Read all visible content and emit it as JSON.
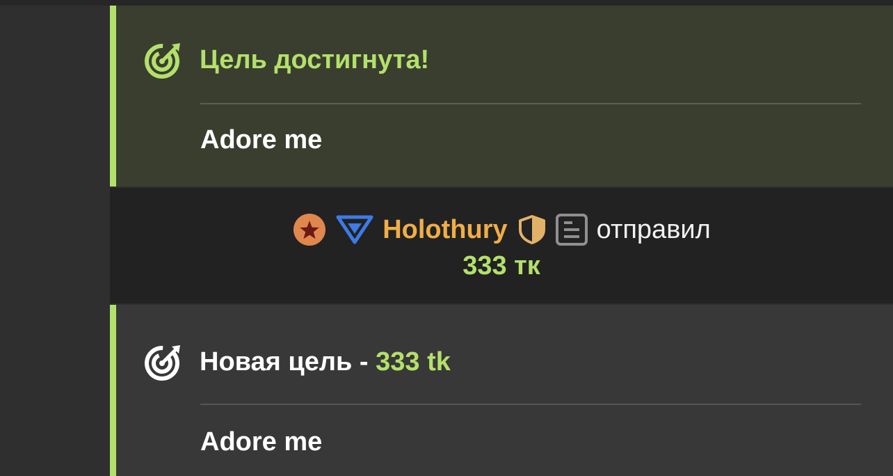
{
  "colors": {
    "accent_green": "#b3e06b",
    "username_orange": "#f0ad48",
    "goal_reached_bg": "#3a3e2f",
    "tip_bg": "#222222",
    "goal_new_bg": "#383838"
  },
  "goal_reached": {
    "icon": "target-icon",
    "title": "Цель достигнута!",
    "name": "Adore me"
  },
  "tip": {
    "badges": [
      "star-badge-icon",
      "blue-triangle-icon"
    ],
    "username": "Holothury",
    "user_icons": [
      "shield-icon",
      "document-icon"
    ],
    "action": "отправил",
    "amount": "333 тк"
  },
  "goal_new": {
    "icon": "target-icon",
    "title_prefix": "Новая цель - ",
    "amount": "333 tk",
    "name": "Adore me"
  }
}
